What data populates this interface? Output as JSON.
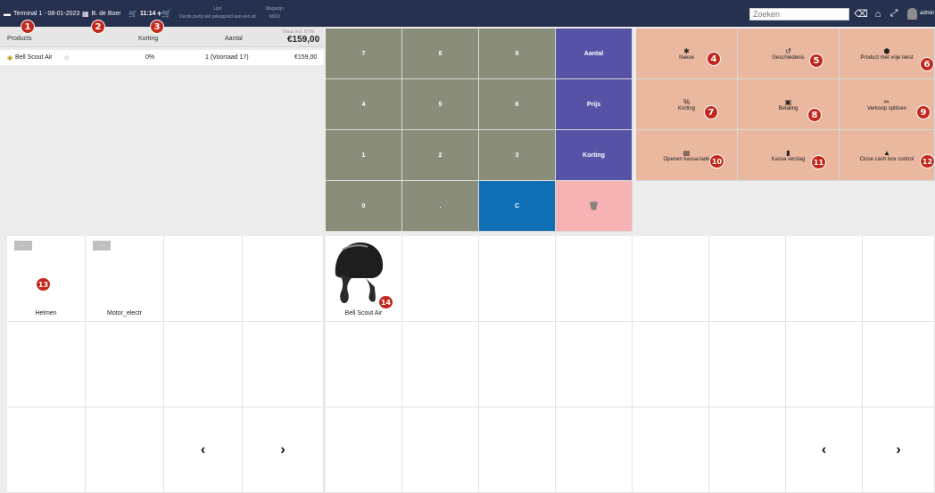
{
  "topbar": {
    "terminal": "Terminal 1 - 08-01-2023",
    "user": "B. de Boer",
    "time": "11:14",
    "list_label": "Lijst",
    "list_value": "Derde partij niet gekoppeld aan een lid",
    "warehouse_label": "Magazijn",
    "warehouse_value": "M001",
    "search_placeholder": "Zoeken",
    "admin": "admin"
  },
  "order": {
    "headers": {
      "products": "Products",
      "discount": "Korting",
      "quantity": "Aantal",
      "total_label": "Totaal incl. BTW",
      "total": "€159,00"
    },
    "lines": [
      {
        "product": "Bell Scout Air",
        "discount": "0%",
        "quantity": "1 (Voorraad 17)",
        "price": "€159,00"
      }
    ]
  },
  "numpad": {
    "k7": "7",
    "k8": "8",
    "k9": "9",
    "quantity": "Aantal",
    "k4": "4",
    "k5": "5",
    "k6": "6",
    "price": "Prijs",
    "k1": "1",
    "k2": "2",
    "k3": "3",
    "discount": "Korting",
    "k0": "0",
    "dot": ".",
    "clear": "C"
  },
  "actions": {
    "new": "Nieuw",
    "history": "Geschiedenis",
    "free_text": "Product met vrije tekst",
    "discount": "Korting",
    "payment": "Betaling",
    "split": "Verkoop splitsen",
    "drawer": "Openen kassa-lade",
    "report": "Kassa verslag",
    "close_cash": "Close cash box control"
  },
  "categories": {
    "items": [
      {
        "label": "Helmen",
        "tag": "..."
      },
      {
        "label": "Motor_electr",
        "tag": "..."
      }
    ]
  },
  "products": {
    "items": [
      {
        "label": "Bell Scout Air"
      }
    ]
  },
  "badges": [
    "1",
    "2",
    "3",
    "4",
    "5",
    "6",
    "7",
    "8",
    "9",
    "10",
    "11",
    "12",
    "13",
    "14"
  ],
  "colors": {
    "topbar": "#25314f",
    "numpad": "#8a8d79",
    "action_purple": "#5653a6",
    "clear_blue": "#0e6fb4",
    "delete_pink": "#f7b3b3",
    "action_salmon": "#eab79f",
    "badge_red": "#c4281c"
  }
}
